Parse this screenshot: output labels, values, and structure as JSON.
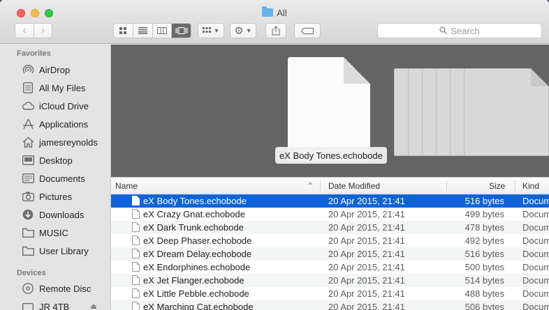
{
  "window": {
    "title": "All"
  },
  "toolbar": {
    "back_icon": "chevron-left-icon",
    "forward_icon": "chevron-right-icon",
    "view_modes": [
      "icon-view",
      "list-view",
      "column-view",
      "cover-flow-view"
    ],
    "active_view": "cover-flow-view",
    "search_placeholder": "Search"
  },
  "sidebar": {
    "favorites_header": "Favorites",
    "favorites": [
      {
        "label": "AirDrop",
        "icon": "airdrop-icon"
      },
      {
        "label": "All My Files",
        "icon": "all-files-icon"
      },
      {
        "label": "iCloud Drive",
        "icon": "cloud-icon"
      },
      {
        "label": "Applications",
        "icon": "applications-icon"
      },
      {
        "label": "jamesreynolds",
        "icon": "home-icon"
      },
      {
        "label": "Desktop",
        "icon": "desktop-icon"
      },
      {
        "label": "Documents",
        "icon": "documents-icon"
      },
      {
        "label": "Pictures",
        "icon": "camera-icon"
      },
      {
        "label": "Downloads",
        "icon": "download-icon"
      },
      {
        "label": "MUSIC",
        "icon": "folder-icon"
      },
      {
        "label": "User Library",
        "icon": "folder-icon"
      }
    ],
    "devices_header": "Devices",
    "devices": [
      {
        "label": "Remote Disc",
        "icon": "disc-icon"
      },
      {
        "label": "JR 4TB",
        "icon": "drive-icon"
      }
    ]
  },
  "coverflow": {
    "selected_label": "eX Body Tones.echobode"
  },
  "list": {
    "columns": {
      "name": "Name",
      "date": "Date Modified",
      "size": "Size",
      "kind": "Kind"
    },
    "rows": [
      {
        "name": "eX Body Tones.echobode",
        "date": "20 Apr 2015, 21:41",
        "size": "516 bytes",
        "kind": "Docum"
      },
      {
        "name": "eX Crazy Gnat.echobode",
        "date": "20 Apr 2015, 21:41",
        "size": "499 bytes",
        "kind": "Docum"
      },
      {
        "name": "eX Dark Trunk.echobode",
        "date": "20 Apr 2015, 21:41",
        "size": "478 bytes",
        "kind": "Docum"
      },
      {
        "name": "eX Deep Phaser.echobode",
        "date": "20 Apr 2015, 21:41",
        "size": "492 bytes",
        "kind": "Docum"
      },
      {
        "name": "eX Dream Delay.echobode",
        "date": "20 Apr 2015, 21:41",
        "size": "516 bytes",
        "kind": "Docum"
      },
      {
        "name": "eX Endorphines.echobode",
        "date": "20 Apr 2015, 21:41",
        "size": "500 bytes",
        "kind": "Docum"
      },
      {
        "name": "eX Jet Flanger.echobode",
        "date": "20 Apr 2015, 21:41",
        "size": "514 bytes",
        "kind": "Docum"
      },
      {
        "name": "eX Little Pebble.echobode",
        "date": "20 Apr 2015, 21:41",
        "size": "488 bytes",
        "kind": "Docum"
      },
      {
        "name": "eX Marching Cat.echobode",
        "date": "20 Apr 2015, 21:41",
        "size": "506 bytes",
        "kind": "Docum"
      }
    ]
  }
}
